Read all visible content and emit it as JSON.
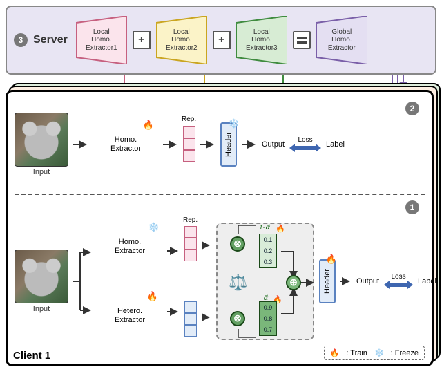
{
  "server": {
    "badge": "3",
    "title": "Server",
    "extractors": [
      {
        "label": "Local\nHomo.\nExtractor1",
        "fill": "#fbe4ec",
        "stroke": "#c6607f"
      },
      {
        "label": "Local\nHomo.\nExtractor2",
        "fill": "#fbf3c8",
        "stroke": "#caa520"
      },
      {
        "label": "Local\nHomo.\nExtractor3",
        "fill": "#d7ecd4",
        "stroke": "#3f8b3f"
      }
    ],
    "op_plus": "+",
    "global": {
      "label": "Global\nHomo.\nExtractor",
      "fill": "#e4dff2",
      "stroke": "#7a5fa8"
    }
  },
  "client": {
    "name": "Client 1",
    "top": {
      "badge": "2",
      "input_label": "Input",
      "ext_label": "Homo.\nExtractor",
      "rep_label": "Rep.",
      "header_label": "Header",
      "output_label": "Output",
      "loss_label": "Loss",
      "label_label": "Label"
    },
    "bot": {
      "badge": "1",
      "input_label": "Input",
      "homo_label": "Homo.\nExtractor",
      "hetero_label": "Hetero.\nExtractor",
      "rep_label": "Rep.",
      "alpha_lo_label": "1-α⃗",
      "alpha_lo_vals": [
        "0.1",
        "0.2",
        "0.3"
      ],
      "alpha_hi_label": "α⃗",
      "alpha_hi_vals": [
        "0.9",
        "0.8",
        "0.7"
      ],
      "header_label": "Header",
      "output_label": "Output",
      "loss_label": "Loss",
      "label_label": "Label"
    }
  },
  "legend": {
    "train_icon": "🔥",
    "train_label": ": Train",
    "freeze_icon": "❄️",
    "freeze_label": ": Freeze"
  },
  "chart_data": {
    "type": "diagram",
    "title": "Federated learning with homogeneous/heterogeneous feature extractors",
    "server_aggregation": {
      "inputs": [
        "Local Homo. Extractor1",
        "Local Homo. Extractor2",
        "Local Homo. Extractor3"
      ],
      "operation": "sum → equals",
      "output": "Global Homo. Extractor"
    },
    "client_stage_2": {
      "flow": [
        "Input",
        "Homo. Extractor (train 🔥)",
        "Rep.",
        "Header (freeze ❄️)",
        "Output",
        "↔ Loss ↔",
        "Label"
      ]
    },
    "client_stage_1": {
      "branches": [
        {
          "name": "Homo. Extractor",
          "state": "freeze",
          "weight_vector": "1-α⃗",
          "weights": [
            0.1,
            0.2,
            0.3
          ]
        },
        {
          "name": "Hetero. Extractor",
          "state": "train",
          "weight_vector": "α⃗",
          "weights": [
            0.9,
            0.8,
            0.7
          ]
        }
      ],
      "combine": "element-wise weighted sum (⊗ then ⊕)",
      "then": [
        "Header (train 🔥)",
        "Output",
        "↔ Loss ↔",
        "Label"
      ]
    },
    "legend": {
      "🔥": "Train",
      "❄️": "Freeze"
    }
  }
}
